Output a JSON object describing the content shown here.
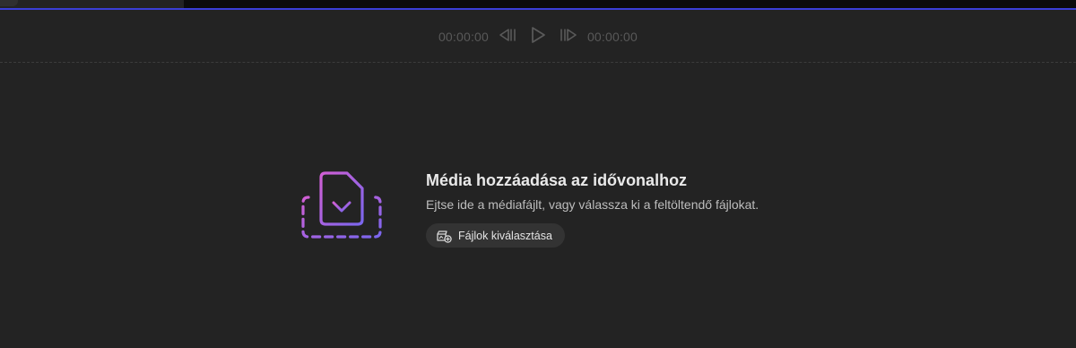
{
  "transport": {
    "current_time": "00:00:00",
    "total_time": "00:00:00",
    "icons": {
      "previous": "step-backward-icon",
      "play": "play-icon",
      "next": "step-forward-icon"
    }
  },
  "dropzone": {
    "title": "Média hozzáadása az idővonalhoz",
    "subtitle": "Ejtse ide a médiafájlt, vagy válassza ki a feltöltendő fájlokat.",
    "button_label": "Fájlok kiválasztása",
    "illustration_icon": "file-download-drop-icon",
    "button_icon": "add-media-icon"
  },
  "colors": {
    "background": "#232323",
    "accent_line": "#3a3ed6",
    "gradient_start": "#c45bd6",
    "gradient_end": "#7b66f0"
  }
}
